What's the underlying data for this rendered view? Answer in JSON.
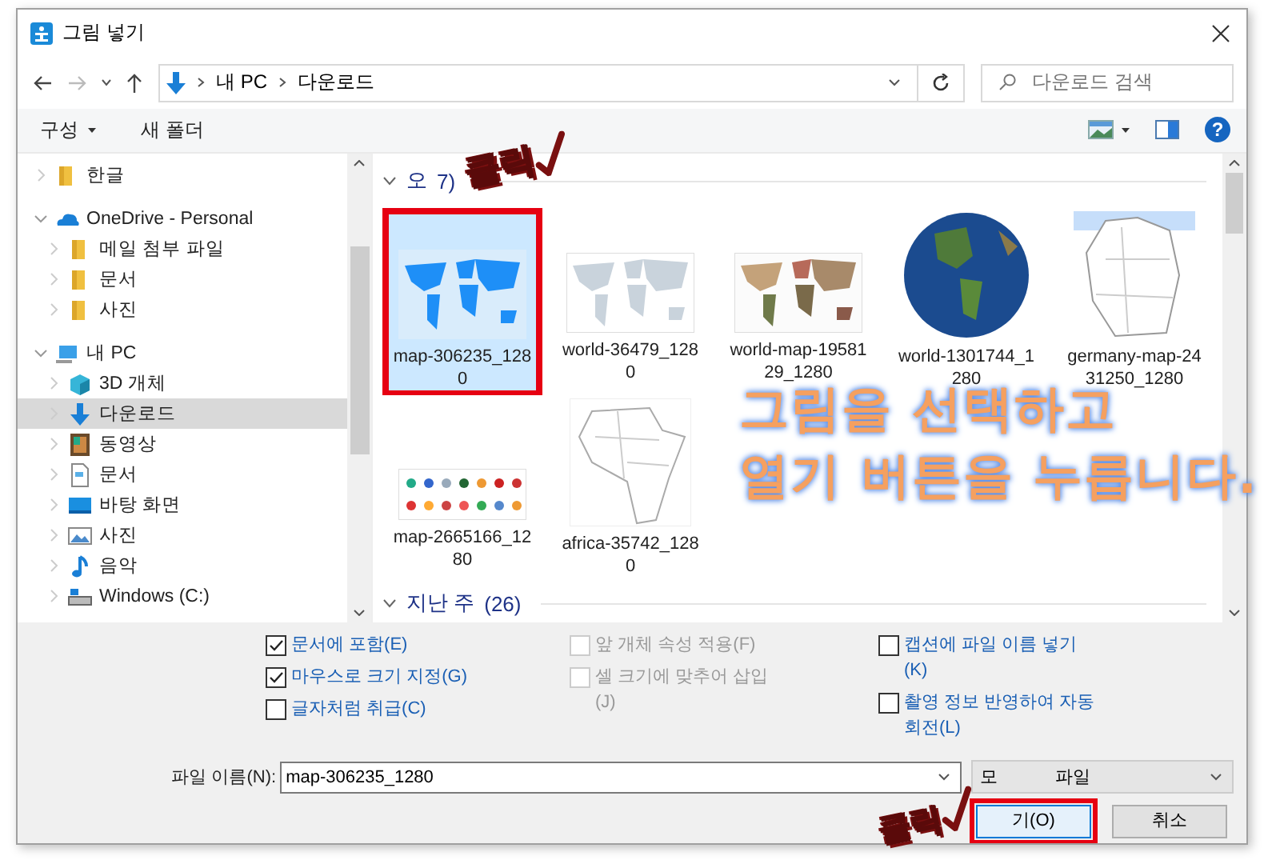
{
  "window": {
    "title": "그림 넣기"
  },
  "address_bar": {
    "path": [
      "내 PC",
      "다운로드"
    ],
    "search_placeholder": "다운로드 검색"
  },
  "toolbar": {
    "buttons": [
      {
        "label": "구성",
        "dropdown": true
      },
      {
        "label": "새 폴더",
        "dropdown": false
      }
    ],
    "help": "?"
  },
  "sidebar": {
    "items": [
      {
        "label": "한글",
        "kind": "folder",
        "expanded": false,
        "selected": false
      },
      {
        "label": "OneDrive - Personal",
        "kind": "cloud",
        "expanded": true,
        "selected": false,
        "children": [
          {
            "label": "메일 첨부 파일",
            "kind": "folder",
            "expanded": false,
            "selected": false
          },
          {
            "label": "문서",
            "kind": "folder",
            "expanded": false,
            "selected": false
          },
          {
            "label": "사진",
            "kind": "folder",
            "expanded": false,
            "selected": false
          }
        ]
      },
      {
        "label": "내 PC",
        "kind": "pc",
        "expanded": true,
        "selected": false,
        "children": [
          {
            "label": "3D 개체",
            "kind": "cube",
            "expanded": false,
            "selected": false
          },
          {
            "label": "다운로드",
            "kind": "download",
            "expanded": false,
            "selected": true
          },
          {
            "label": "동영상",
            "kind": "video",
            "expanded": false,
            "selected": false
          },
          {
            "label": "문서",
            "kind": "document",
            "expanded": false,
            "selected": false
          },
          {
            "label": "바탕 화면",
            "kind": "desktop",
            "expanded": false,
            "selected": false
          },
          {
            "label": "사진",
            "kind": "picture",
            "expanded": false,
            "selected": false
          },
          {
            "label": "음악",
            "kind": "music",
            "expanded": false,
            "selected": false
          },
          {
            "label": "Windows (C:)",
            "kind": "drive",
            "expanded": false,
            "selected": false
          }
        ]
      }
    ]
  },
  "content": {
    "groups": [
      {
        "title": "오",
        "count": "7)",
        "expanded": true,
        "items": [
          {
            "name": "map-306235_1280",
            "kind": "world-blue",
            "selected": true,
            "highlighted": true
          },
          {
            "name": "world-36479_1280",
            "kind": "world-grey",
            "selected": false,
            "highlighted": false
          },
          {
            "name": "world-map-1958129_1280",
            "kind": "world-color",
            "selected": false,
            "highlighted": false
          },
          {
            "name": "world-1301744_1280",
            "kind": "globe",
            "selected": false,
            "highlighted": false
          },
          {
            "name": "germany-map-2431250_1280",
            "kind": "germany",
            "selected": false,
            "highlighted": false
          },
          {
            "name": "map-2665166_1280",
            "kind": "pins",
            "selected": false,
            "highlighted": false
          },
          {
            "name": "africa-35742_1280",
            "kind": "africa",
            "selected": false,
            "highlighted": false
          }
        ]
      },
      {
        "title": "지난 주",
        "count": "(26)",
        "expanded": true
      }
    ]
  },
  "options": {
    "columns": [
      [
        {
          "label": "문서에 포함(E)",
          "checked": true,
          "disabled": false
        },
        {
          "label": "마우스로 크기 지정(G)",
          "checked": true,
          "disabled": false
        },
        {
          "label": "글자처럼 취급(C)",
          "checked": false,
          "disabled": false
        }
      ],
      [
        {
          "label": "앞 개체 속성 적용(F)",
          "checked": false,
          "disabled": true
        },
        {
          "label": "셀 크기에 맞추어 삽입(J)",
          "checked": false,
          "disabled": true
        }
      ],
      [
        {
          "label": "캡션에 파일 이름 넣기(K)",
          "checked": false,
          "disabled": false
        },
        {
          "label": "촬영 정보 반영하여 자동 회전(L)",
          "checked": false,
          "disabled": false
        }
      ]
    ]
  },
  "file_name": {
    "label": "파일 이름(N):",
    "value": "map-306235_1280"
  },
  "file_type": {
    "parts": [
      "모",
      "파일"
    ]
  },
  "buttons": [
    {
      "kind": "open",
      "label": "기(O)",
      "highlighted": true
    },
    {
      "kind": "cancel",
      "label": "취소",
      "highlighted": false
    }
  ],
  "annotations": {
    "click_marks": [
      "클릭",
      "클릭"
    ],
    "caption": [
      "그림을 선택하고",
      "열기 버튼을 누릅니다."
    ]
  }
}
